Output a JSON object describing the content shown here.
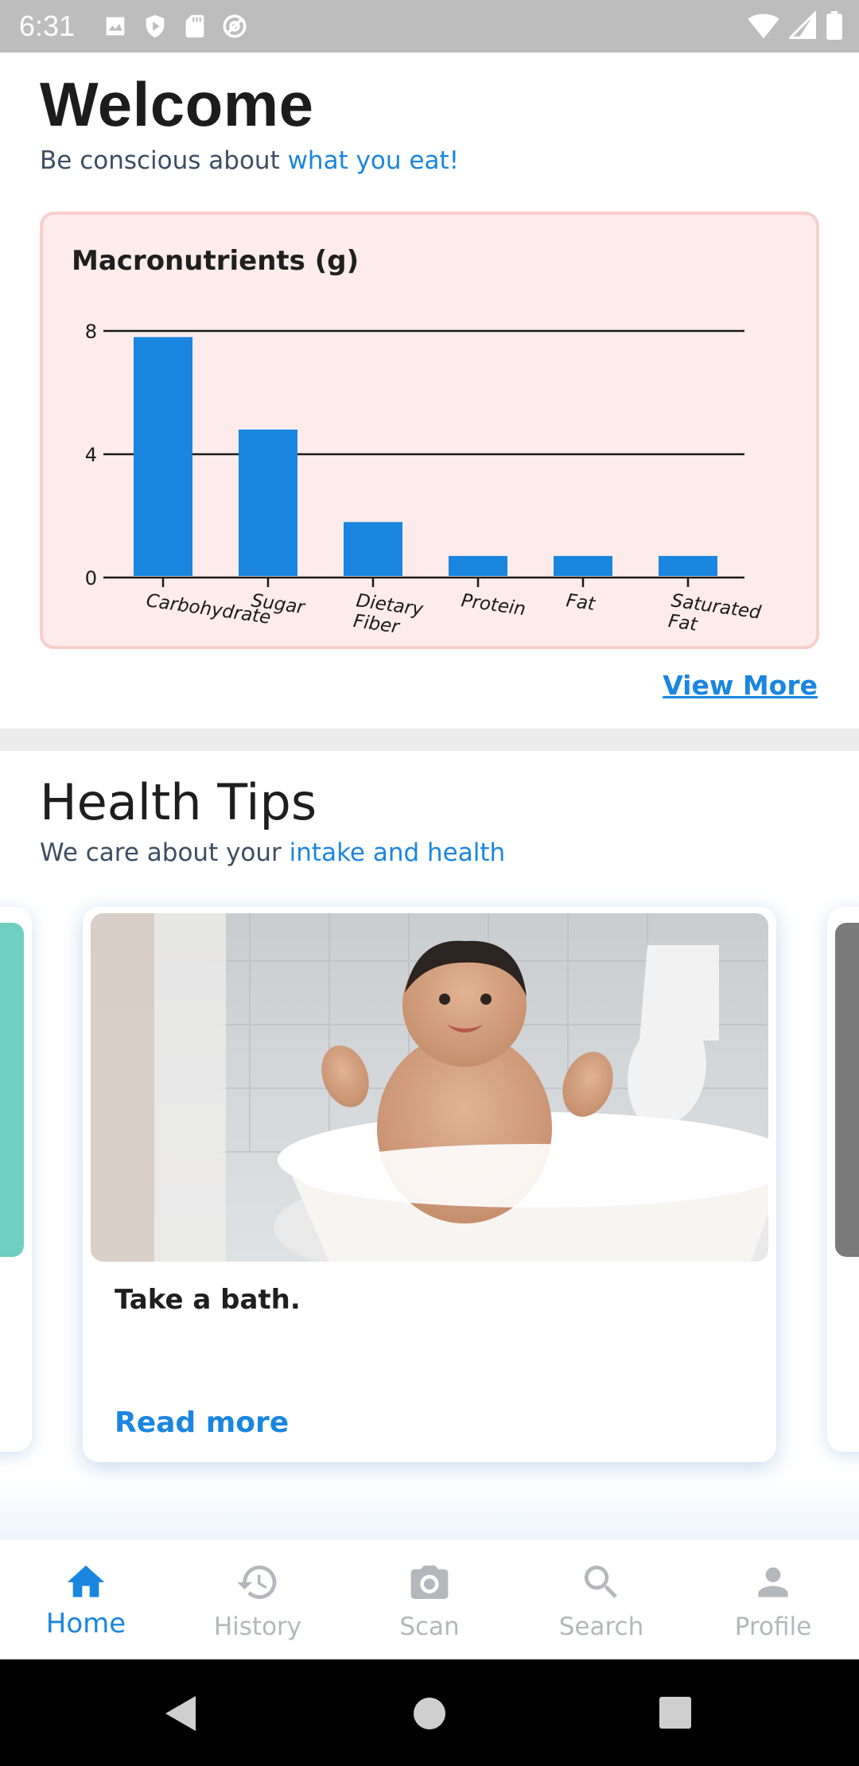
{
  "status_bar": {
    "time": "6:31",
    "left_icons": [
      "image-icon",
      "shield-play-icon",
      "sd-card-icon",
      "at-sign-icon"
    ],
    "right_icons": [
      "wifi-icon",
      "cell-signal-icon",
      "battery-icon"
    ]
  },
  "header": {
    "title": "Welcome",
    "subtitle_plain": "Be conscious about ",
    "subtitle_accent": "what you eat!"
  },
  "chart_data": {
    "type": "bar",
    "title": "Macronutrients (g)",
    "categories": [
      "Carbohydrate",
      "Sugar",
      "Dietary Fiber",
      "Protein",
      "Fat",
      "Saturated Fat"
    ],
    "values": [
      7.8,
      4.8,
      1.8,
      0.7,
      0.7,
      0.7
    ],
    "yticks": [
      0,
      4,
      8
    ],
    "ylim": [
      0,
      8
    ],
    "xlabel": "",
    "ylabel": "",
    "grid": true,
    "bar_color": "#1a86e0"
  },
  "view_more_label": "View More",
  "tips": {
    "title": "Health Tips",
    "subtitle_plain": "We care about your ",
    "subtitle_accent": "intake and health",
    "card": {
      "text": "Take a bath.",
      "read_more": "Read more"
    }
  },
  "bottom_nav": {
    "items": [
      {
        "label": "Home",
        "icon": "home-icon",
        "active": true
      },
      {
        "label": "History",
        "icon": "history-icon",
        "active": false
      },
      {
        "label": "Scan",
        "icon": "camera-icon",
        "active": false
      },
      {
        "label": "Search",
        "icon": "search-icon",
        "active": false
      },
      {
        "label": "Profile",
        "icon": "person-icon",
        "active": false
      }
    ]
  },
  "colors": {
    "accent": "#1a86e0",
    "card_bg": "#fdeceb",
    "card_border": "#f9cfcc",
    "inactive": "#b4b8bc"
  }
}
